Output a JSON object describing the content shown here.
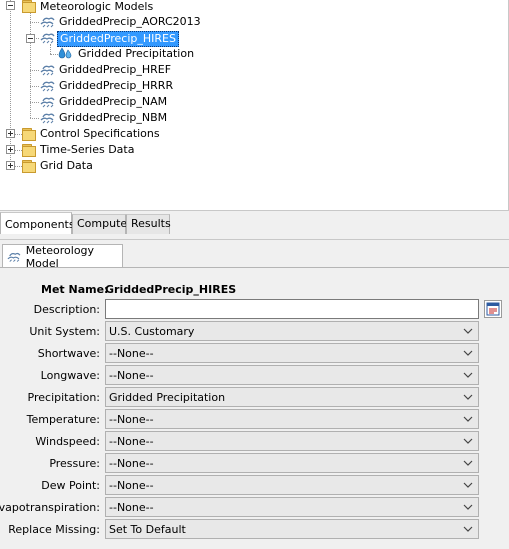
{
  "tree": {
    "met_models_label": "Meteorologic Models",
    "models": [
      {
        "label": "GriddedPrecip_AORC2013",
        "selected": false
      },
      {
        "label": "GriddedPrecip_HIRES",
        "selected": true
      },
      {
        "label": "GriddedPrecip_HREF",
        "selected": false
      },
      {
        "label": "GriddedPrecip_HRRR",
        "selected": false
      },
      {
        "label": "GriddedPrecip_NAM",
        "selected": false
      },
      {
        "label": "GriddedPrecip_NBM",
        "selected": false
      }
    ],
    "child_label": "Gridded Precipitation",
    "control_specs_label": "Control Specifications",
    "time_series_label": "Time-Series Data",
    "grid_data_label": "Grid Data"
  },
  "tabs": {
    "components": "Components",
    "compute": "Compute",
    "results": "Results"
  },
  "editor": {
    "tab_label": "Meteorology Model",
    "met_name_label": "Met Name:",
    "met_name_value": "GriddedPrecip_HIRES",
    "description_label": "Description:",
    "description_value": "",
    "fields": [
      {
        "label": "Unit System:",
        "value": "U.S. Customary"
      },
      {
        "label": "Shortwave:",
        "value": "--None--"
      },
      {
        "label": "Longwave:",
        "value": "--None--"
      },
      {
        "label": "Precipitation:",
        "value": "Gridded Precipitation"
      },
      {
        "label": "Temperature:",
        "value": "--None--"
      },
      {
        "label": "Windspeed:",
        "value": "--None--"
      },
      {
        "label": "Pressure:",
        "value": "--None--"
      },
      {
        "label": "Dew Point:",
        "value": "--None--"
      },
      {
        "label": "Evapotranspiration:",
        "value": "--None--"
      },
      {
        "label": "Replace Missing:",
        "value": "Set To Default"
      }
    ]
  },
  "colors": {
    "selection": "#3399ff",
    "panel_bg": "#f0f0f0",
    "folder": "#f6d878",
    "met_icon": "#5b7fa8",
    "drops": "#2f8fd8"
  },
  "icons": {
    "folder": "folder-icon",
    "met_model": "meteorologic-model-icon",
    "precip": "precipitation-drops-icon",
    "expander_open": "collapse-icon",
    "expander_closed": "expand-icon",
    "chevron": "chevron-down-icon",
    "description_button": "edit-description-icon"
  }
}
